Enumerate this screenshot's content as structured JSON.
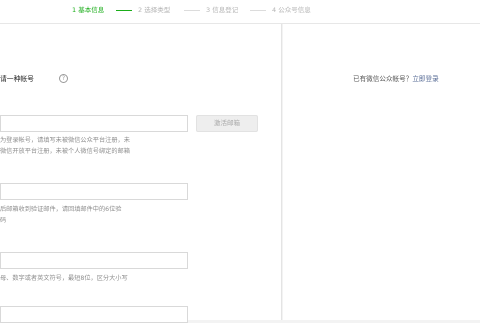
{
  "steps": [
    {
      "label": "1 基本信息",
      "active": true
    },
    {
      "label": "2 选择类型",
      "active": false
    },
    {
      "label": "3 信息登记",
      "active": false
    },
    {
      "label": "4 公众号信息",
      "active": false
    }
  ],
  "form": {
    "title": "请一种帐号",
    "help_icon": "?",
    "activate_button": "激活邮箱",
    "email_tip_line1": "为登录帐号，请填写未被微信公众平台注册，未",
    "email_tip_line2": "微信开放平台注册，未被个人微信号绑定的邮箱",
    "code_tip_line1": "后邮箱收到验证邮件，请回填邮件中的6位验",
    "code_tip_line2": "码",
    "password_tip": "母、数字或者英文符号，最短8位，区分大小写"
  },
  "side": {
    "question": "已有微信公众帐号？",
    "login_link": "立即登录"
  },
  "colors": {
    "accent": "#1aad19",
    "link": "#576b95"
  }
}
